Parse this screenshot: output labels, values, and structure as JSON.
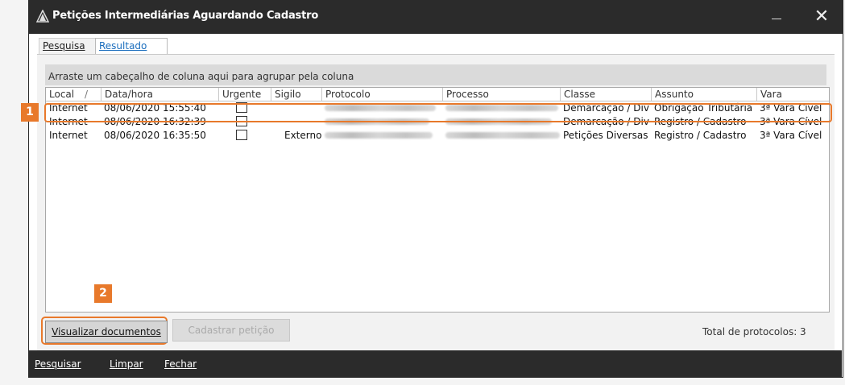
{
  "window": {
    "title": "Petições Intermediárias Aguardando Cadastro"
  },
  "tabs": [
    {
      "label": "Pesquisa"
    },
    {
      "label": "Resultado"
    }
  ],
  "grid": {
    "group_hint": "Arraste um cabeçalho de coluna aqui para agrupar pela coluna",
    "columns": [
      "Local",
      "Data/hora",
      "Urgente",
      "Sigilo",
      "Protocolo",
      "Processo",
      "Classe",
      "Assunto",
      "Vara"
    ],
    "rows": [
      {
        "local": "Internet",
        "datahora": "08/06/2020 15:55:40",
        "urgente": false,
        "sigilo": "",
        "classe": "Demarcação / Div",
        "assunto": "Obrigação Tributária",
        "vara": "3ª Vara Cível"
      },
      {
        "local": "Internet",
        "datahora": "08/06/2020 16:32:39",
        "urgente": false,
        "sigilo": "",
        "classe": "Demarcação / Div",
        "assunto": "Registro / Cadastro",
        "vara": "3ª Vara Cível"
      },
      {
        "local": "Internet",
        "datahora": "08/06/2020 16:35:50",
        "urgente": false,
        "sigilo": "Externo",
        "classe": "Petições Diversas",
        "assunto": "Registro / Cadastro",
        "vara": "3ª Vara Cível"
      }
    ]
  },
  "callouts": {
    "one": "1",
    "two": "2"
  },
  "buttons": {
    "visualizar": "Visualizar documentos",
    "cadastrar": "Cadastrar petição"
  },
  "status": {
    "total": "Total de protocolos: 3"
  },
  "bottom_menu": {
    "pesquisar": "Pesquisar",
    "limpar": "Limpar",
    "fechar": "Fechar"
  },
  "colors": {
    "accent": "#e8792b",
    "titlebar": "#2b2b2b",
    "active_tab": "#1a6dbd"
  },
  "icons": {
    "app": "app-logo-icon",
    "sort": "sort-ascending-icon",
    "minimize": "minimize-icon",
    "close": "close-icon"
  }
}
